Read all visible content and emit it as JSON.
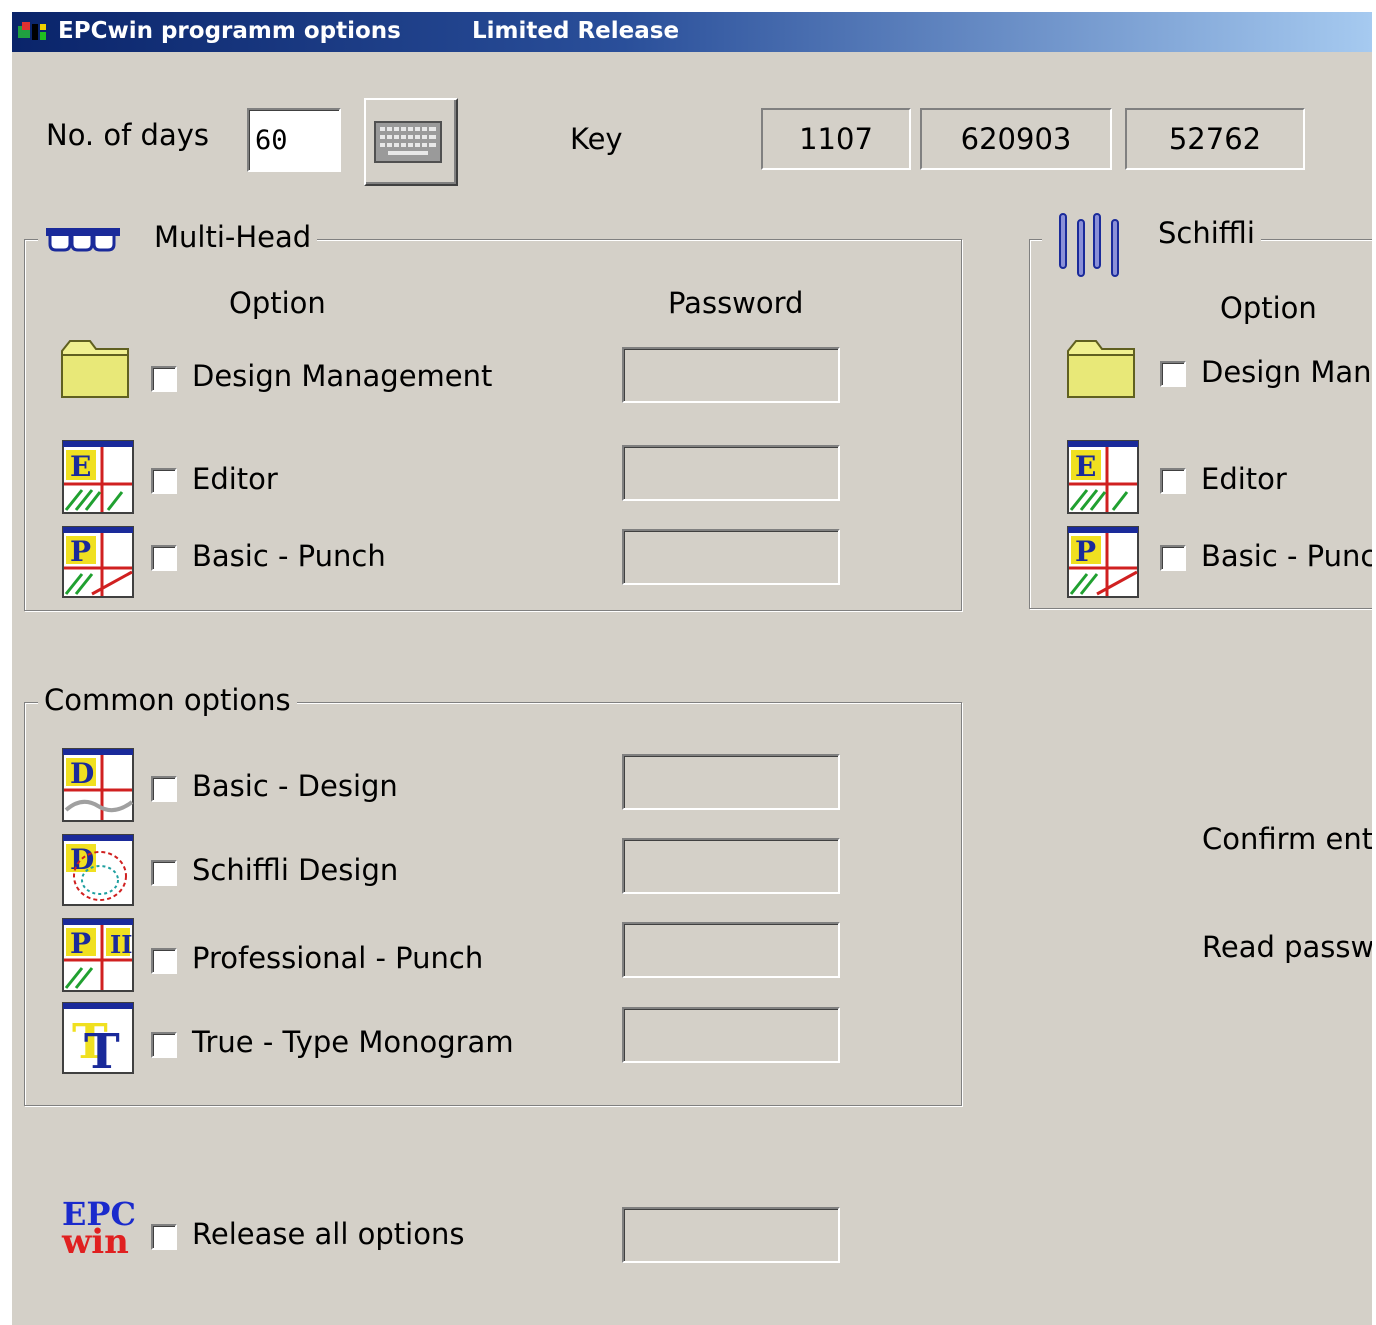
{
  "window": {
    "title": "EPCwin programm options",
    "subtitle": "Limited Release"
  },
  "top": {
    "days_label": "No. of days",
    "days_value": "60",
    "key_label": "Key",
    "keys": [
      "1107",
      "620903",
      "52762"
    ]
  },
  "multihead": {
    "legend": "Multi-Head",
    "option_header": "Option",
    "password_header": "Password",
    "items": [
      {
        "label": "Design Management",
        "icon": "folder-icon",
        "checked": false
      },
      {
        "label": "Editor",
        "icon": "editor-icon",
        "checked": false
      },
      {
        "label": "Basic - Punch",
        "icon": "punch-icon",
        "checked": false
      }
    ]
  },
  "schiffli": {
    "legend": "Schiffli",
    "option_header": "Option",
    "items": [
      {
        "label": "Design Man",
        "icon": "folder-icon",
        "checked": false
      },
      {
        "label": "Editor",
        "icon": "editor-icon",
        "checked": false
      },
      {
        "label": "Basic - Punc",
        "icon": "punch-icon",
        "checked": false
      }
    ]
  },
  "common": {
    "legend": "Common options",
    "items": [
      {
        "label": "Basic - Design",
        "icon": "design-icon",
        "checked": false
      },
      {
        "label": "Schiffli Design",
        "icon": "schiffli-design-icon",
        "checked": false
      },
      {
        "label": "Professional - Punch",
        "icon": "professional-punch-icon",
        "checked": false
      },
      {
        "label": "True - Type Monogram",
        "icon": "truetype-icon",
        "checked": false
      }
    ]
  },
  "release": {
    "logo_top": "EPC",
    "logo_bottom": "win",
    "label": "Release all options"
  },
  "right_labels": {
    "confirm": "Confirm ente",
    "read": "Read passw"
  }
}
